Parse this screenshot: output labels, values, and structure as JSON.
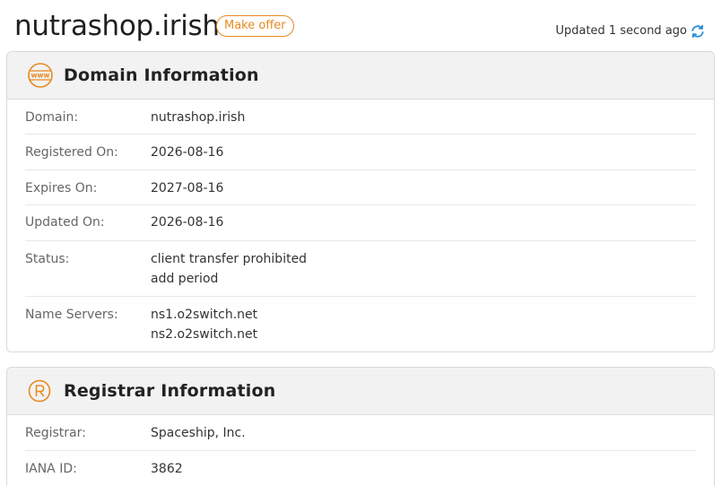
{
  "header": {
    "domain": "nutrashop.irish",
    "offer_label": "Make offer",
    "updated_text": "Updated 1 second ago"
  },
  "domain_info": {
    "title": "Domain Information",
    "icon_text": "www",
    "rows": [
      {
        "label": "Domain:",
        "values": [
          "nutrashop.irish"
        ]
      },
      {
        "label": "Registered On:",
        "values": [
          "2026-08-16"
        ]
      },
      {
        "label": "Expires On:",
        "values": [
          "2027-08-16"
        ]
      },
      {
        "label": "Updated On:",
        "values": [
          "2026-08-16"
        ]
      },
      {
        "label": "Status:",
        "values": [
          "client transfer prohibited",
          "add period"
        ]
      },
      {
        "label": "Name Servers:",
        "values": [
          "ns1.o2switch.net",
          "ns2.o2switch.net"
        ]
      }
    ]
  },
  "registrar_info": {
    "title": "Registrar Information",
    "rows": [
      {
        "label": "Registrar:",
        "values": [
          "Spaceship, Inc."
        ]
      },
      {
        "label": "IANA ID:",
        "values": [
          "3862"
        ]
      }
    ]
  },
  "colors": {
    "accent": "#e8891f",
    "refresh": "#2a8fd6",
    "header_bg": "#f2f2f2"
  },
  "icons": {
    "domain": "www-globe-icon",
    "registrar": "registered-icon",
    "refresh": "refresh-icon"
  }
}
